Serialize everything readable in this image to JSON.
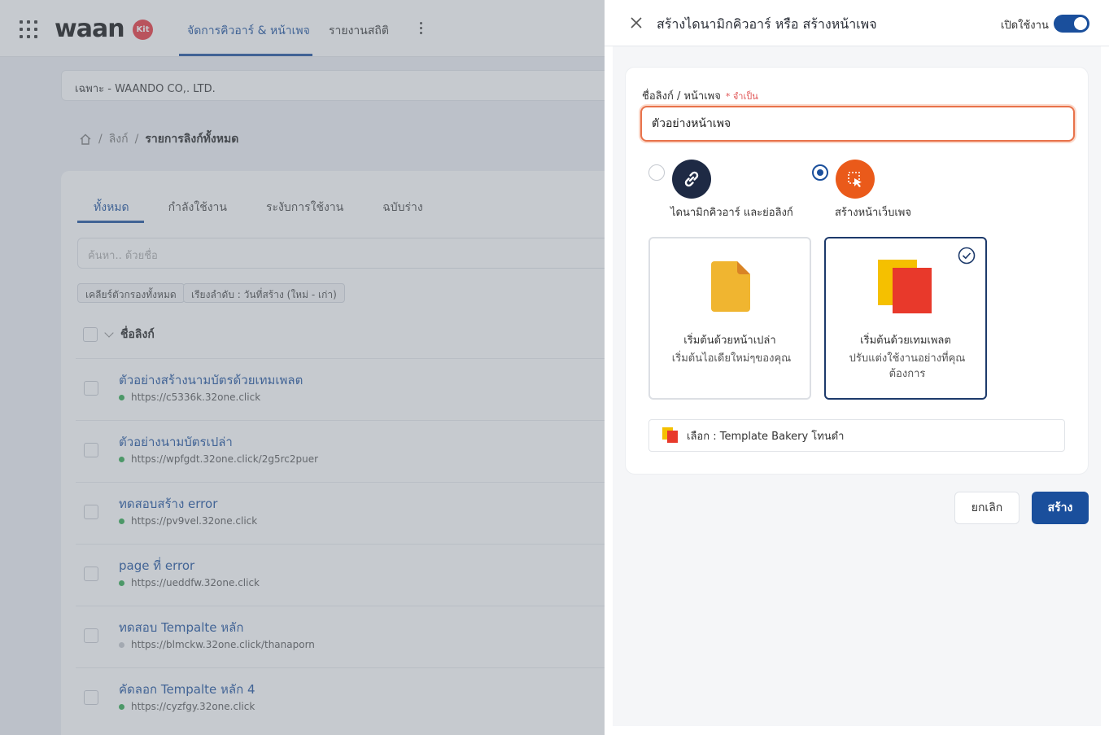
{
  "topbar": {
    "logo_text": "waan",
    "logo_badge": "Kit",
    "nav": [
      "จัดการคิวอาร์ & หน้าเพจ",
      "รายงานสถิติ"
    ]
  },
  "company": "เฉพาะ - WAANDO CO,. LTD.",
  "breadcrumb": {
    "link": "ลิงก์",
    "current": "รายการลิงก์ทั้งหมด"
  },
  "list": {
    "tabs": [
      "ทั้งหมด",
      "กำลังใช้งาน",
      "ระงับการใช้งาน",
      "ฉบับร่าง"
    ],
    "search_placeholder": "ค้นหา.. ด้วยชื่อ",
    "chip_clear": "เคลียร์ตัวกรองทั้งหมด",
    "chip_sort": "เรียงลำดับ : วันที่สร้าง (ใหม่ - เก่า)",
    "column_header": "ชื่อลิงก์",
    "rows": [
      {
        "title": "ตัวอย่างสร้างนามบัตรด้วยเทมเพลต",
        "url": "https://c5336k.32one.click",
        "status": "active"
      },
      {
        "title": "ตัวอย่างนามบัตรเปล่า",
        "url": "https://wpfgdt.32one.click/2g5rc2puer",
        "status": "active"
      },
      {
        "title": "ทดสอบสร้าง error",
        "url": "https://pv9vel.32one.click",
        "status": "active"
      },
      {
        "title": "page ที่ error",
        "url": "https://ueddfw.32one.click",
        "status": "active"
      },
      {
        "title": "ทดสอบ Tempalte หลัก",
        "url": "https://blmckw.32one.click/thanaporn",
        "status": "inactive"
      },
      {
        "title": "คัดลอก Tempalte หลัก 4",
        "url": "https://cyzfgy.32one.click",
        "status": "active"
      }
    ]
  },
  "drawer": {
    "title": "สร้างไดนามิกคิวอาร์ หรือ สร้างหน้าเพจ",
    "toggle_label": "เปิดใช้งาน",
    "toggle_on": true,
    "field_label": "ชื่อลิงก์ / หน้าเพจ",
    "field_required": "* จำเป็น",
    "field_value": "ตัวอย่างหน้าเพจ",
    "options": [
      {
        "label": "ไดนามิกคิวอาร์ และย่อลิงก์",
        "icon": "link-icon",
        "selected": false
      },
      {
        "label": "สร้างหน้าเว็บเพจ",
        "icon": "webpage-cursor-icon",
        "selected": true
      }
    ],
    "choices": [
      {
        "title": "เริ่มต้นด้วยหน้าเปล่า",
        "subtitle": "เริ่มต้นไอเดียใหม่ๆของคุณ",
        "icon": "blank-file-icon",
        "selected": false
      },
      {
        "title": "เริ่มต้นด้วยเทมเพลต",
        "subtitle": "ปรับแต่งใช้งานอย่างที่คุณต้องการ",
        "icon": "template-icon",
        "selected": true
      }
    ],
    "template_selected": "เลือก : Template Bakery โทนดำ",
    "cancel_label": "ยกเลิก",
    "create_label": "สร้าง"
  },
  "colors": {
    "primary": "#1a4f9c",
    "input_focus": "#e8724a",
    "required": "#e05252",
    "orange": "#ea5a1a",
    "navy_circle": "#1e2a44"
  }
}
